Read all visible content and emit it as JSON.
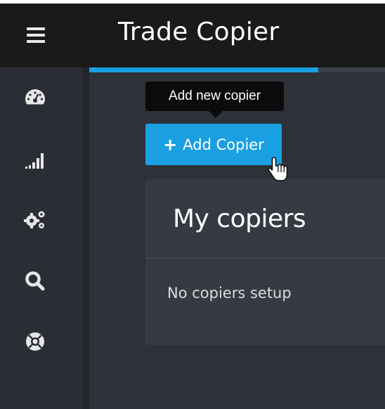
{
  "header": {
    "title": "Trade Copier"
  },
  "sidebar": {
    "items": [
      {
        "icon": "dashboard-icon"
      },
      {
        "icon": "signal-bars-icon"
      },
      {
        "icon": "gears-icon"
      },
      {
        "icon": "search-icon"
      },
      {
        "icon": "lifebuoy-icon"
      }
    ]
  },
  "tooltip": {
    "text": "Add new copier"
  },
  "add_button": {
    "label": "Add Copier",
    "icon": "+"
  },
  "card": {
    "title": "My copiers",
    "empty_text": "No copiers setup"
  },
  "colors": {
    "accent": "#1aa0e2",
    "header_bg": "#1a1a1a",
    "sidebar_bg": "#2a2e34",
    "main_bg": "#2d3138",
    "card_bg": "#363b43"
  }
}
